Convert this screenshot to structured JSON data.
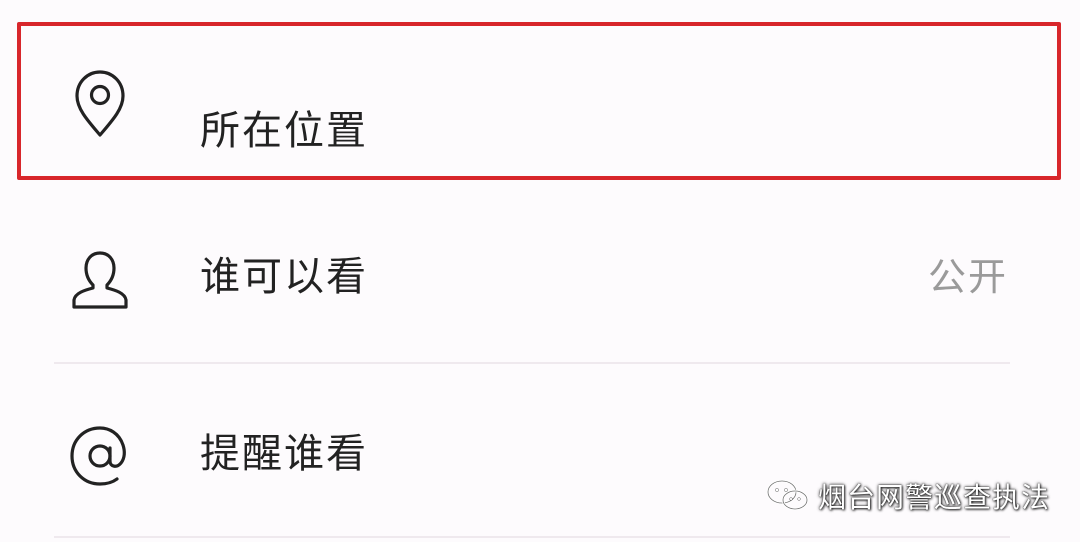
{
  "colors": {
    "background": "#fdfbfd",
    "highlight_border": "#d8262b",
    "label": "#222222",
    "value": "#9a9a9a",
    "divider": "#efe9ee"
  },
  "rows": [
    {
      "label": "所在位置",
      "value": "",
      "icon": "location-pin-icon",
      "highlighted": true
    },
    {
      "label": "谁可以看",
      "value": "公开",
      "icon": "person-icon",
      "highlighted": false
    },
    {
      "label": "提醒谁看",
      "value": "",
      "icon": "at-sign-icon",
      "highlighted": false
    }
  ],
  "watermark": {
    "text": "烟台网警巡查执法",
    "icon": "wechat-icon"
  }
}
